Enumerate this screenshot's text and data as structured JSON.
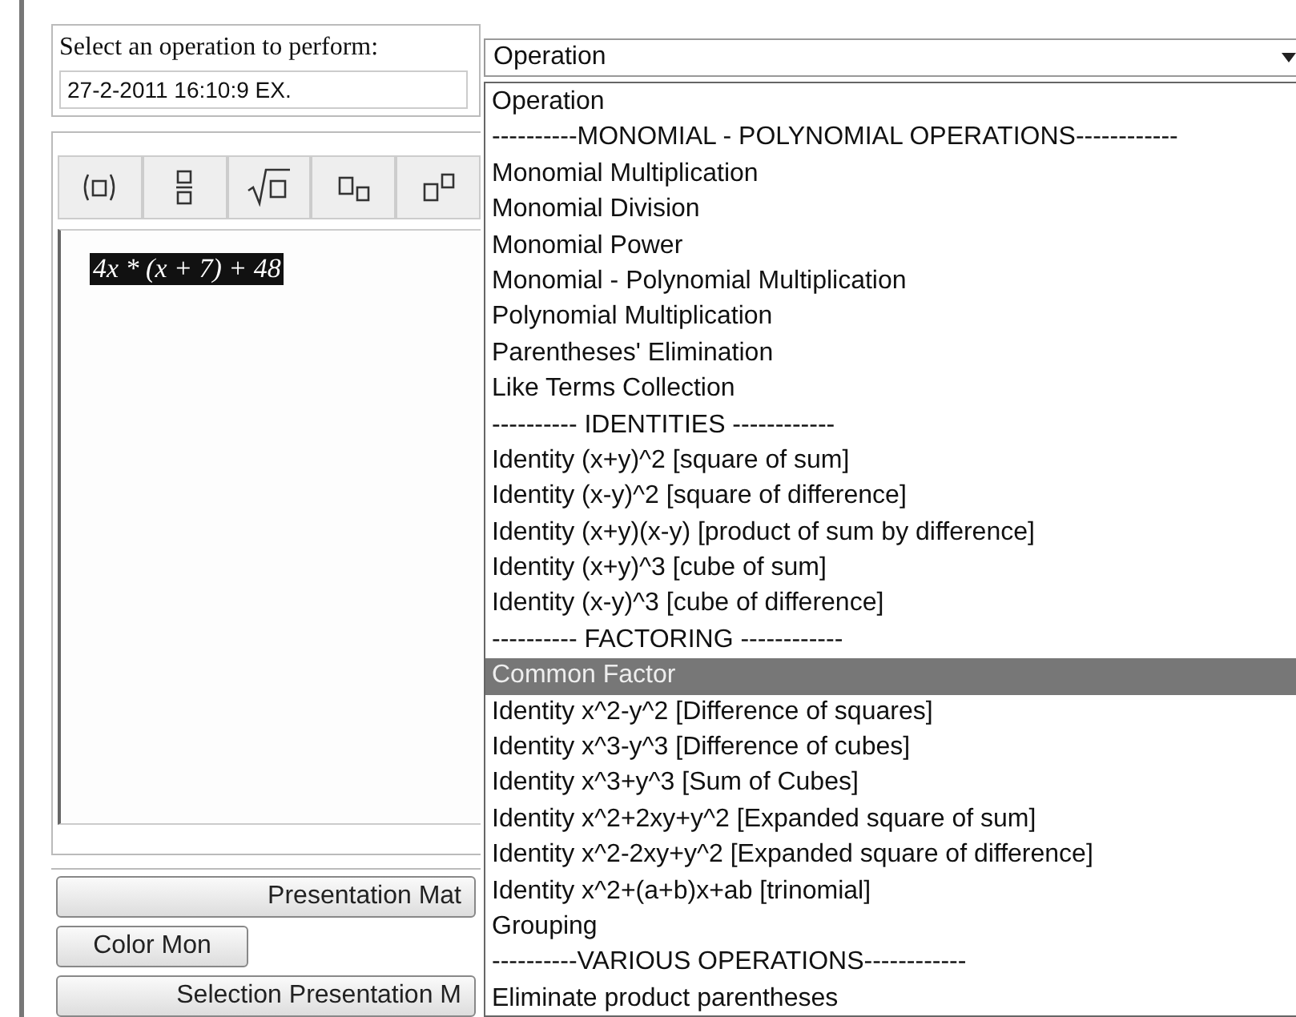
{
  "form": {
    "label": "Select an operation to perform:",
    "select": {
      "value": "Operation",
      "open": true
    },
    "date_field": {
      "value": "27-2-2011 16:10:9 EX."
    }
  },
  "toolbar": [
    {
      "kind": "parentheses"
    },
    {
      "kind": "fraction"
    },
    {
      "kind": "root"
    },
    {
      "kind": "subscript"
    },
    {
      "kind": "superscript"
    }
  ],
  "editor": {
    "expression": "4x * (x + 7) + 48",
    "selected": true
  },
  "buttons": [
    {
      "label": "Presentation Mat",
      "kind": "wide"
    },
    {
      "label": "Color Mon",
      "kind": "small"
    },
    {
      "label": "Selection Presentation M",
      "kind": "wide"
    }
  ],
  "options": [
    {
      "label": "Operation",
      "selected": false
    },
    {
      "label": "----------MONOMIAL - POLYNOMIAL OPERATIONS------------",
      "selected": false
    },
    {
      "label": "Monomial Multiplication",
      "selected": false
    },
    {
      "label": "Monomial Division",
      "selected": false
    },
    {
      "label": "Monomial Power",
      "selected": false
    },
    {
      "label": "Monomial - Polynomial Multiplication",
      "selected": false
    },
    {
      "label": "Polynomial Multiplication",
      "selected": false
    },
    {
      "label": "Parentheses' Elimination",
      "selected": false
    },
    {
      "label": "Like Terms Collection",
      "selected": false
    },
    {
      "label": "---------- IDENTITIES ------------",
      "selected": false
    },
    {
      "label": "Identity (x+y)^2 [square of sum]",
      "selected": false
    },
    {
      "label": "Identity (x-y)^2 [square of difference]",
      "selected": false
    },
    {
      "label": "Identity (x+y)(x-y) [product of sum by difference]",
      "selected": false
    },
    {
      "label": "Identity (x+y)^3 [cube of sum]",
      "selected": false
    },
    {
      "label": "Identity (x-y)^3 [cube of difference]",
      "selected": false
    },
    {
      "label": "---------- FACTORING ------------",
      "selected": false
    },
    {
      "label": "Common Factor",
      "selected": true
    },
    {
      "label": "Identity x^2-y^2 [Difference of squares]",
      "selected": false
    },
    {
      "label": "Identity x^3-y^3 [Difference of cubes]",
      "selected": false
    },
    {
      "label": "Identity x^3+y^3 [Sum of Cubes]",
      "selected": false
    },
    {
      "label": "Identity x^2+2xy+y^2 [Expanded square of sum]",
      "selected": false
    },
    {
      "label": "Identity x^2-2xy+y^2 [Expanded square of difference]",
      "selected": false
    },
    {
      "label": "Identity x^2+(a+b)x+ab [trinomial]",
      "selected": false
    },
    {
      "label": "Grouping",
      "selected": false
    },
    {
      "label": "----------VARIOUS OPERATIONS------------",
      "selected": false
    },
    {
      "label": "Eliminate product parentheses",
      "selected": false
    }
  ]
}
